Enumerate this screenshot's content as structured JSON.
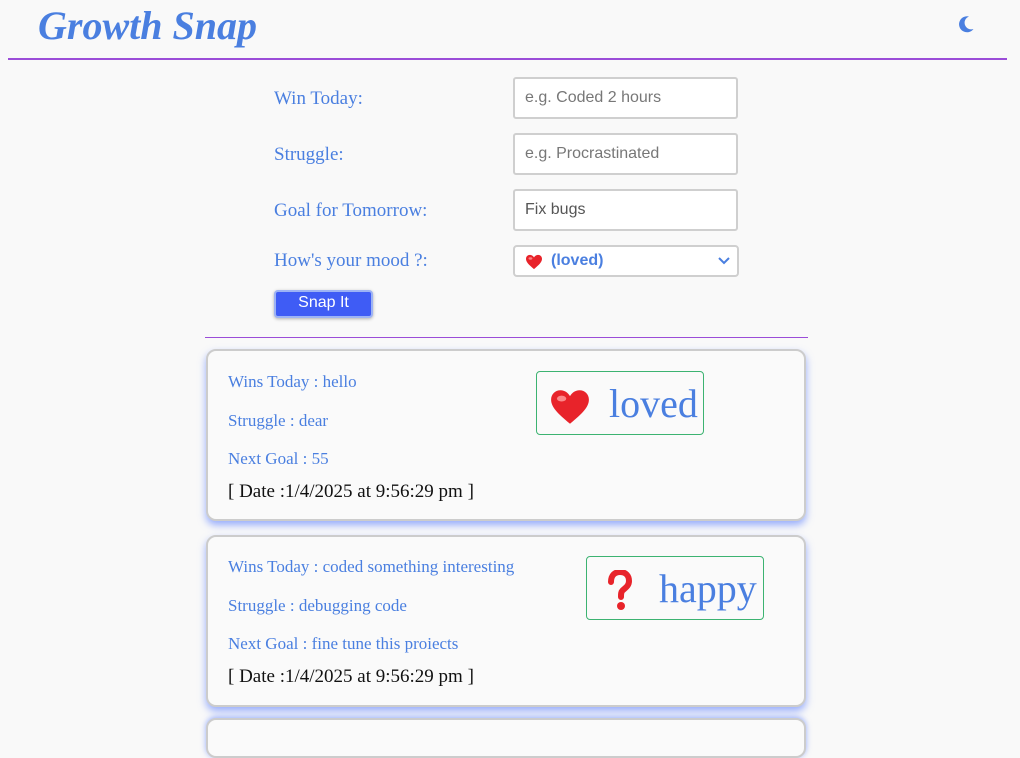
{
  "header": {
    "title": "Growth Snap",
    "theme_icon": "moon-icon"
  },
  "form": {
    "win_label": "Win Today:",
    "win_placeholder": "e.g. Coded 2 hours",
    "win_value": "",
    "struggle_label": "Struggle:",
    "struggle_placeholder": "e.g. Procrastinated",
    "struggle_value": "",
    "goal_label": "Goal for Tomorrow:",
    "goal_placeholder": "",
    "goal_value": "Fix bugs",
    "mood_label": "How's your mood ?:",
    "mood_selected": "(loved)",
    "mood_selected_icon": "heart-icon",
    "submit_label": "Snap It"
  },
  "entries": [
    {
      "wins": "Wins Today : hello",
      "struggle": "Struggle : dear",
      "next_goal": "Next Goal : 55",
      "date": "[ Date :1/4/2025 at 9:56:29 pm ]",
      "mood": "loved",
      "mood_icon": "heart-icon"
    },
    {
      "wins": "Wins Today : coded something interesting",
      "struggle": "Struggle : debugging code",
      "next_goal": "Next Goal : fine tune this proiects",
      "date": "[ Date :1/4/2025 at 9:56:29 pm ]",
      "mood": "happy",
      "mood_icon": "question-mark-icon"
    }
  ],
  "colors": {
    "accent": "#4a7fe0",
    "divider": "#9b4dd8",
    "button": "#3f5cf5",
    "mood_border": "#3cb371",
    "emoji_red": "#e8232a"
  }
}
